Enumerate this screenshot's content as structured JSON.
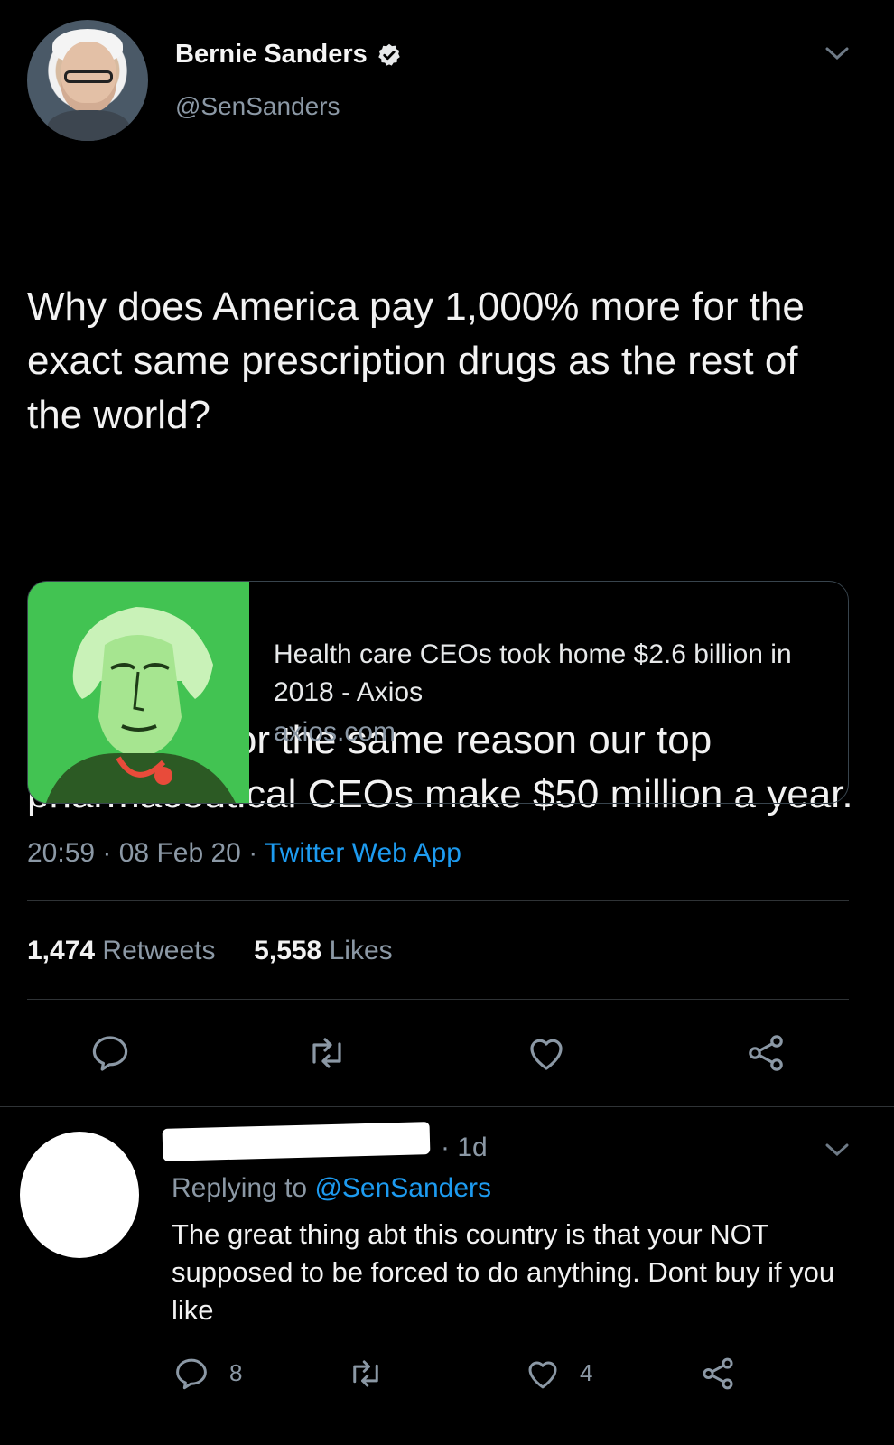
{
  "tweet": {
    "author_name": "Bernie Sanders",
    "author_handle": "@SenSanders",
    "text_p1": "Why does America pay 1,000% more for the exact same prescription drugs as the rest of the world?",
    "text_p2": "It might be for the same reason our top pharmaceutical CEOs make $50 million a year.",
    "card": {
      "title": "Health care CEOs took home $2.6 billion in 2018 - Axios",
      "domain": "axios.com"
    },
    "time": "20:59",
    "date": "08 Feb 20",
    "app": "Twitter Web App",
    "retweets_count": "1,474",
    "retweets_label": "Retweets",
    "likes_count": "5,558",
    "likes_label": "Likes"
  },
  "reply": {
    "time": "1d",
    "replying_prefix": "Replying to",
    "replying_handle": "@SenSanders",
    "text": "The great thing abt this country is that your NOT supposed to be forced to do anything. Dont buy if you like",
    "reply_count": "8",
    "like_count": "4"
  },
  "icons": [
    "verified-icon",
    "chevron-down-icon",
    "reply-icon",
    "retweet-icon",
    "like-icon",
    "share-icon"
  ],
  "colors": {
    "background": "#000000",
    "link": "#1d9bf0",
    "muted": "#8b98a5",
    "card_green": "#42c352"
  }
}
